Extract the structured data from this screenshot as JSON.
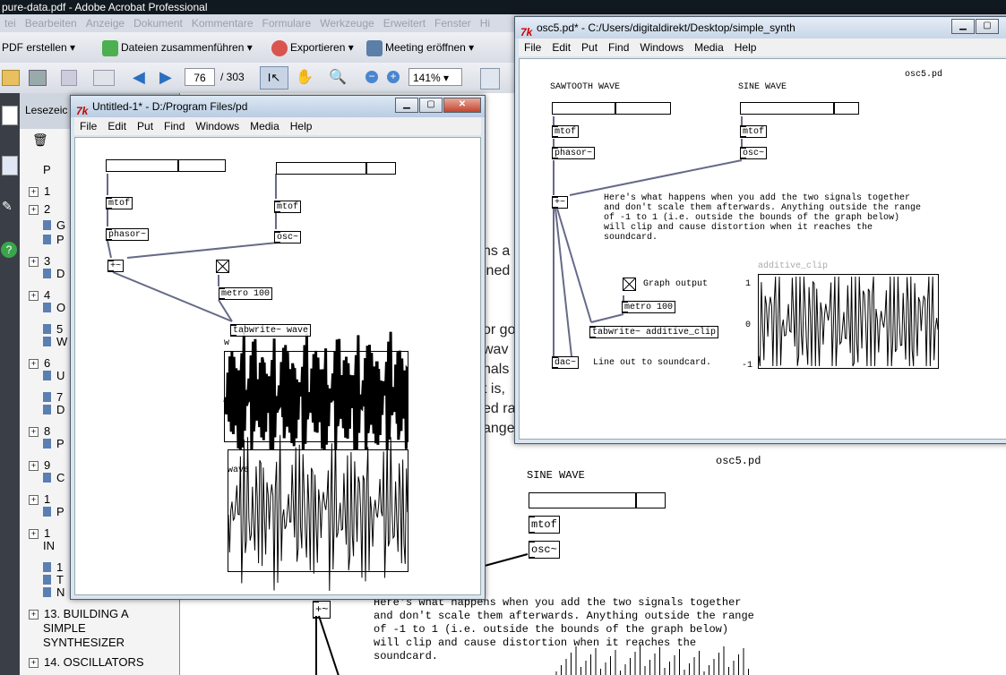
{
  "acrobat": {
    "title": "pure-data.pdf - Adobe Acrobat Professional",
    "menu": [
      "tei",
      "Bearbeiten",
      "Anzeige",
      "Dokument",
      "Kommentare",
      "Formulare",
      "Werkzeuge",
      "Erweitert",
      "Fenster",
      "Hi"
    ],
    "toolbar": {
      "pdf_erstellen": "PDF erstellen",
      "dateien": "Dateien zusammenführen",
      "exportieren": "Exportieren",
      "meeting": "Meeting eröffnen"
    },
    "page_current": "76",
    "page_total": "/ 303",
    "zoom": "141%",
    "bookmarks_tab": "Lesezeic",
    "bookmarks": [
      {
        "plus": false,
        "text": "P"
      },
      {
        "plus": true,
        "text": "1"
      },
      {
        "plus": true,
        "text": "2"
      },
      {
        "plus": false,
        "text": "G"
      },
      {
        "plus": false,
        "text": "P"
      },
      {
        "plus": true,
        "text": "3"
      },
      {
        "plus": false,
        "text": "D"
      },
      {
        "plus": true,
        "text": "4"
      },
      {
        "plus": false,
        "text": "O"
      },
      {
        "plus": false,
        "text": "5"
      },
      {
        "plus": false,
        "text": "W"
      },
      {
        "plus": true,
        "text": "6"
      },
      {
        "plus": false,
        "text": "U"
      },
      {
        "plus": false,
        "text": "7"
      },
      {
        "plus": false,
        "text": "D"
      },
      {
        "plus": true,
        "text": "8"
      },
      {
        "plus": false,
        "text": "P"
      },
      {
        "plus": true,
        "text": "9"
      },
      {
        "plus": false,
        "text": "C"
      },
      {
        "plus": true,
        "text": "1"
      },
      {
        "plus": false,
        "text": "P"
      },
      {
        "plus": true,
        "text": "1"
      },
      {
        "plus": false,
        "text": "IN"
      },
      {
        "plus": false,
        "text": "1"
      },
      {
        "plus": false,
        "text": "T"
      },
      {
        "plus": false,
        "text": "N"
      },
      {
        "plus": true,
        "text": "13. BUILDING A"
      },
      {
        "plus": false,
        "text": "SIMPLE"
      },
      {
        "plus": false,
        "text": "SYNTHESIZER"
      },
      {
        "plus": true,
        "text": "14. OSCILLATORS"
      }
    ],
    "page_fragments": [
      "ns a",
      "ined",
      "or go",
      "wav",
      "nals",
      "t is,",
      "ed ra",
      "ange"
    ],
    "page": {
      "heading": "osc5.pd",
      "sine_label": "SINE WAVE",
      "mtof": "mtof",
      "osc": "osc~",
      "plus": "+~",
      "paragraph": "Here's what happens when you add the two signals together\nand don't scale them afterwards. Anything outside the range\nof -1 to 1 (i.e. outside the bounds of the graph below)\nwill clip and cause distortion when it reaches the\nsoundcard."
    }
  },
  "win1": {
    "title": "Untitled-1* - D:/Program Files/pd",
    "menu": [
      "File",
      "Edit",
      "Put",
      "Find",
      "Windows",
      "Media",
      "Help"
    ],
    "mtof1": "mtof",
    "mtof2": "mtof",
    "phasor": "phasor~",
    "osc": "osc~",
    "plus": "+~",
    "metro": "metro 100",
    "tabwrite": "tabwrite~ wave",
    "graph1_label": "w",
    "graph2_label": "wave",
    "slider1_level": 0.6,
    "slider2_level": 0.75
  },
  "win2": {
    "title": "osc5.pd* - C:/Users/digitaldirekt/Desktop/simple_synth",
    "menu": [
      "File",
      "Edit",
      "Put",
      "Find",
      "Windows",
      "Media",
      "Help"
    ],
    "heading": "osc5.pd",
    "saw_label": "SAWTOOTH WAVE",
    "sine_label": "SINE WAVE",
    "mtof": "mtof",
    "mtof2": "mtof",
    "phasor": "phasor~",
    "osc": "osc~",
    "plus": "+~",
    "paragraph": "Here's what happens when you add the two signals together\nand don't scale them afterwards. Anything outside the range\nof -1 to 1 (i.e. outside the bounds of the graph below)\nwill clip and cause distortion when it reaches the\nsoundcard.",
    "graph_output": "Graph output",
    "metro": "metro 100",
    "tabwrite": "tabwrite~ additive_clip",
    "dac": "dac~",
    "line_out": "Line out to soundcard.",
    "graph_label": "additive_clip",
    "y_ticks": [
      "1",
      "0",
      "-1"
    ],
    "slider1_level": 0.53,
    "slider2_level": 0.79
  }
}
